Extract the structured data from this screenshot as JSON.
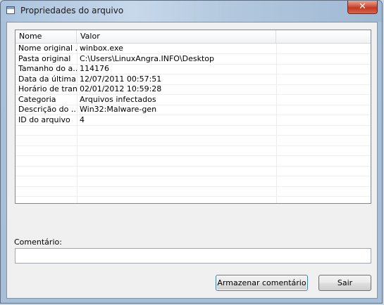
{
  "window": {
    "title": "Propriedades do arquivo",
    "close_glyph": "✕"
  },
  "list": {
    "columns": [
      "Nome",
      "Valor",
      ""
    ],
    "rows": [
      {
        "name": "Nome original ...",
        "value": "winbox.exe"
      },
      {
        "name": "Pasta original",
        "value": "C:\\Users\\LinuxAngra.INFO\\Desktop"
      },
      {
        "name": "Tamanho do a...",
        "value": "114176"
      },
      {
        "name": "Data da última...",
        "value": "12/07/2011 00:57:51"
      },
      {
        "name": "Horário de tran...",
        "value": "02/01/2012 10:59:28"
      },
      {
        "name": "Categoria",
        "value": "Arquivos infectados"
      },
      {
        "name": "Descrição do ...",
        "value": "Win32:Malware-gen"
      },
      {
        "name": "ID do arquivo",
        "value": "4"
      }
    ]
  },
  "comment": {
    "label": "Comentário:",
    "value": ""
  },
  "buttons": {
    "store": "Armazenar comentário",
    "exit": "Sair"
  }
}
